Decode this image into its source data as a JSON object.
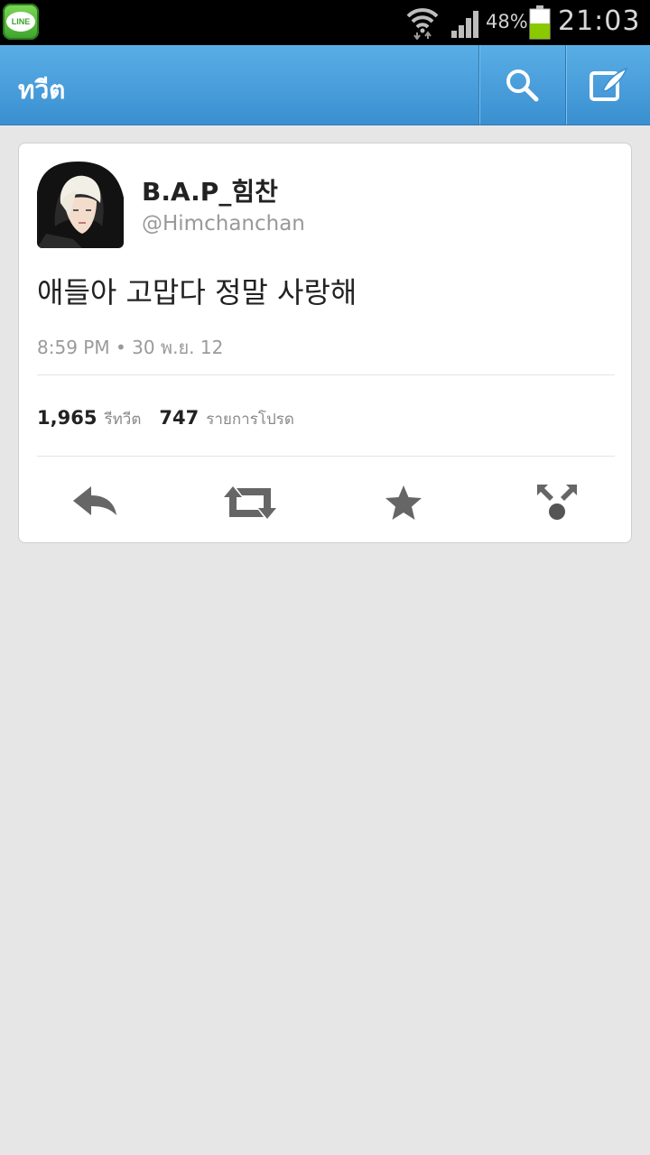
{
  "status_bar": {
    "notification_app": "LINE",
    "battery_percent": "48%",
    "battery_level": 0.48,
    "time": "21:03",
    "icons": [
      "line-app-icon",
      "wifi-icon",
      "cell-signal-icon",
      "battery-icon"
    ]
  },
  "action_bar": {
    "title": "ทวีต",
    "buttons": [
      {
        "name": "search",
        "icon": "search-icon"
      },
      {
        "name": "compose",
        "icon": "compose-icon"
      }
    ]
  },
  "tweet": {
    "display_name": "B.A.P_힘찬",
    "handle": "@Himchanchan",
    "text": "애들아 고맙다 정말 사랑해",
    "timestamp": "8:59 PM • 30 พ.ย. 12",
    "retweets_count": "1,965",
    "retweets_label": "รีทวีต",
    "favorites_count": "747",
    "favorites_label": "รายการโปรด",
    "actions": [
      {
        "name": "reply",
        "icon": "reply-icon"
      },
      {
        "name": "retweet",
        "icon": "retweet-icon"
      },
      {
        "name": "favorite",
        "icon": "star-icon"
      },
      {
        "name": "share",
        "icon": "share-icon"
      }
    ]
  },
  "colors": {
    "action_bar": "#4a9edc",
    "background": "#e6e6e6",
    "card": "#ffffff"
  }
}
